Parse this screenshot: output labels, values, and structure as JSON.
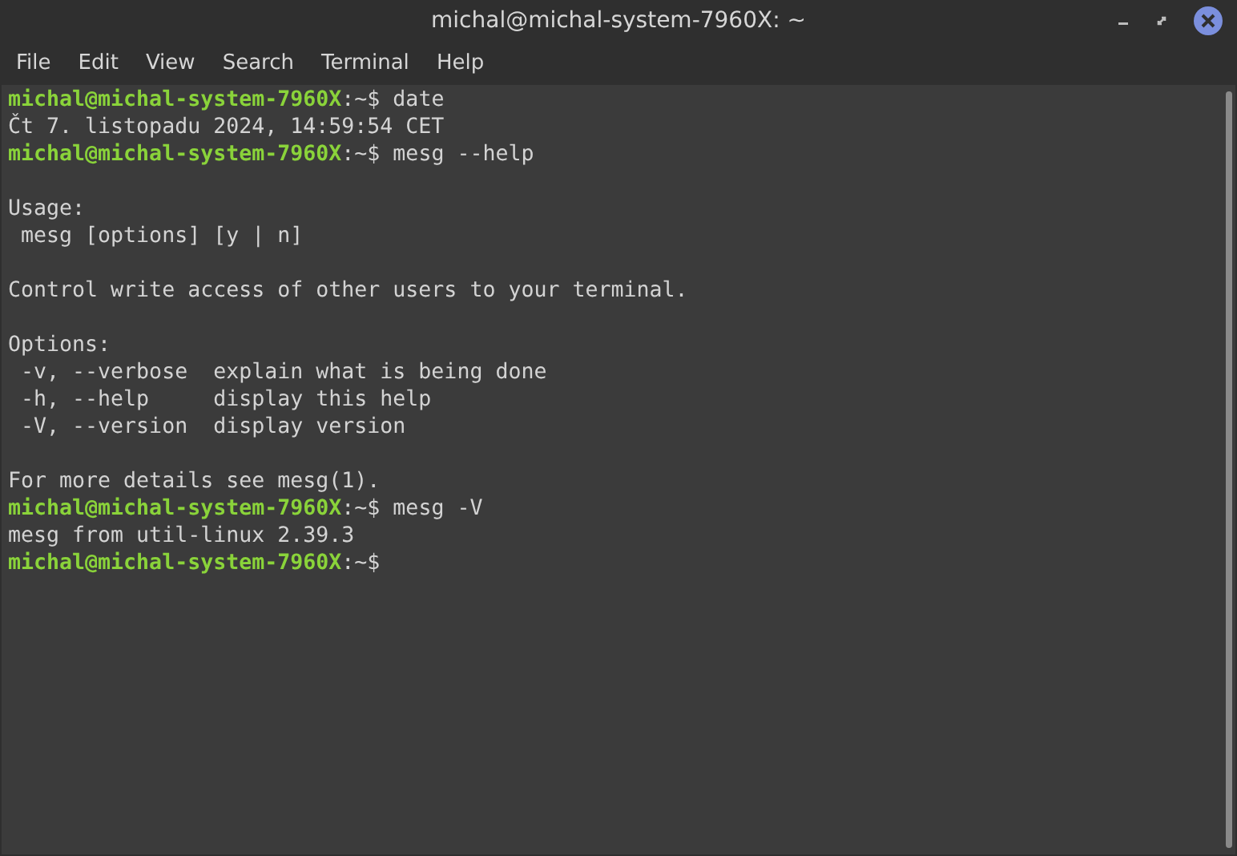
{
  "window": {
    "title": "michal@michal-system-7960X: ~"
  },
  "menu": [
    "File",
    "Edit",
    "View",
    "Search",
    "Terminal",
    "Help"
  ],
  "lines": [
    {
      "kind": "prompt",
      "user_host": "michal@michal-system-7960X",
      "path": ":~$",
      "command": "date"
    },
    {
      "kind": "output",
      "text": "Čt 7. listopadu 2024, 14:59:54 CET"
    },
    {
      "kind": "prompt",
      "user_host": "michal@michal-system-7960X",
      "path": ":~$",
      "command": "mesg --help"
    },
    {
      "kind": "blank"
    },
    {
      "kind": "output",
      "text": "Usage:"
    },
    {
      "kind": "output",
      "text": " mesg [options] [y | n]"
    },
    {
      "kind": "blank"
    },
    {
      "kind": "output",
      "text": "Control write access of other users to your terminal."
    },
    {
      "kind": "blank"
    },
    {
      "kind": "output",
      "text": "Options:"
    },
    {
      "kind": "output",
      "text": " -v, --verbose  explain what is being done"
    },
    {
      "kind": "output",
      "text": " -h, --help     display this help"
    },
    {
      "kind": "output",
      "text": " -V, --version  display version"
    },
    {
      "kind": "blank"
    },
    {
      "kind": "output",
      "text": "For more details see mesg(1)."
    },
    {
      "kind": "prompt",
      "user_host": "michal@michal-system-7960X",
      "path": ":~$",
      "command": "mesg -V"
    },
    {
      "kind": "output",
      "text": "mesg from util-linux 2.39.3"
    },
    {
      "kind": "prompt",
      "user_host": "michal@michal-system-7960X",
      "path": ":~$"
    }
  ]
}
